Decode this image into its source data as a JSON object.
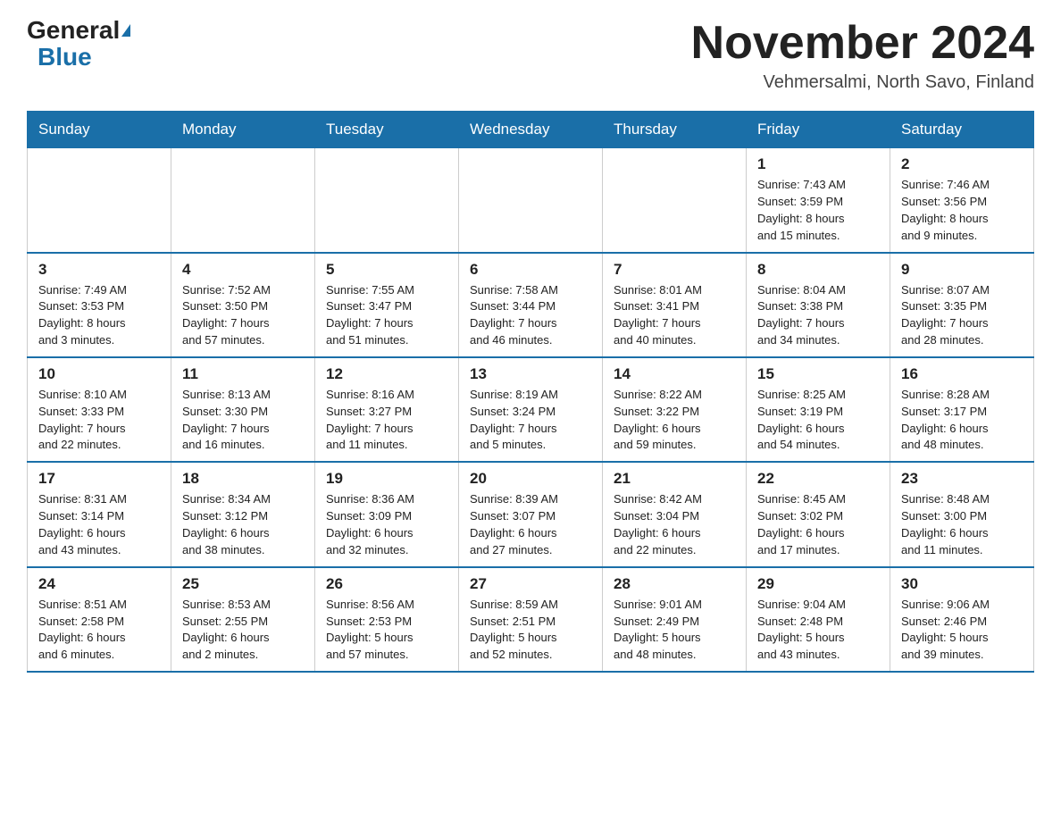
{
  "header": {
    "logo_general": "General",
    "logo_blue": "Blue",
    "month_title": "November 2024",
    "location": "Vehmersalmi, North Savo, Finland"
  },
  "days_of_week": [
    "Sunday",
    "Monday",
    "Tuesday",
    "Wednesday",
    "Thursday",
    "Friday",
    "Saturday"
  ],
  "weeks": [
    [
      {
        "day": "",
        "info": ""
      },
      {
        "day": "",
        "info": ""
      },
      {
        "day": "",
        "info": ""
      },
      {
        "day": "",
        "info": ""
      },
      {
        "day": "",
        "info": ""
      },
      {
        "day": "1",
        "info": "Sunrise: 7:43 AM\nSunset: 3:59 PM\nDaylight: 8 hours\nand 15 minutes."
      },
      {
        "day": "2",
        "info": "Sunrise: 7:46 AM\nSunset: 3:56 PM\nDaylight: 8 hours\nand 9 minutes."
      }
    ],
    [
      {
        "day": "3",
        "info": "Sunrise: 7:49 AM\nSunset: 3:53 PM\nDaylight: 8 hours\nand 3 minutes."
      },
      {
        "day": "4",
        "info": "Sunrise: 7:52 AM\nSunset: 3:50 PM\nDaylight: 7 hours\nand 57 minutes."
      },
      {
        "day": "5",
        "info": "Sunrise: 7:55 AM\nSunset: 3:47 PM\nDaylight: 7 hours\nand 51 minutes."
      },
      {
        "day": "6",
        "info": "Sunrise: 7:58 AM\nSunset: 3:44 PM\nDaylight: 7 hours\nand 46 minutes."
      },
      {
        "day": "7",
        "info": "Sunrise: 8:01 AM\nSunset: 3:41 PM\nDaylight: 7 hours\nand 40 minutes."
      },
      {
        "day": "8",
        "info": "Sunrise: 8:04 AM\nSunset: 3:38 PM\nDaylight: 7 hours\nand 34 minutes."
      },
      {
        "day": "9",
        "info": "Sunrise: 8:07 AM\nSunset: 3:35 PM\nDaylight: 7 hours\nand 28 minutes."
      }
    ],
    [
      {
        "day": "10",
        "info": "Sunrise: 8:10 AM\nSunset: 3:33 PM\nDaylight: 7 hours\nand 22 minutes."
      },
      {
        "day": "11",
        "info": "Sunrise: 8:13 AM\nSunset: 3:30 PM\nDaylight: 7 hours\nand 16 minutes."
      },
      {
        "day": "12",
        "info": "Sunrise: 8:16 AM\nSunset: 3:27 PM\nDaylight: 7 hours\nand 11 minutes."
      },
      {
        "day": "13",
        "info": "Sunrise: 8:19 AM\nSunset: 3:24 PM\nDaylight: 7 hours\nand 5 minutes."
      },
      {
        "day": "14",
        "info": "Sunrise: 8:22 AM\nSunset: 3:22 PM\nDaylight: 6 hours\nand 59 minutes."
      },
      {
        "day": "15",
        "info": "Sunrise: 8:25 AM\nSunset: 3:19 PM\nDaylight: 6 hours\nand 54 minutes."
      },
      {
        "day": "16",
        "info": "Sunrise: 8:28 AM\nSunset: 3:17 PM\nDaylight: 6 hours\nand 48 minutes."
      }
    ],
    [
      {
        "day": "17",
        "info": "Sunrise: 8:31 AM\nSunset: 3:14 PM\nDaylight: 6 hours\nand 43 minutes."
      },
      {
        "day": "18",
        "info": "Sunrise: 8:34 AM\nSunset: 3:12 PM\nDaylight: 6 hours\nand 38 minutes."
      },
      {
        "day": "19",
        "info": "Sunrise: 8:36 AM\nSunset: 3:09 PM\nDaylight: 6 hours\nand 32 minutes."
      },
      {
        "day": "20",
        "info": "Sunrise: 8:39 AM\nSunset: 3:07 PM\nDaylight: 6 hours\nand 27 minutes."
      },
      {
        "day": "21",
        "info": "Sunrise: 8:42 AM\nSunset: 3:04 PM\nDaylight: 6 hours\nand 22 minutes."
      },
      {
        "day": "22",
        "info": "Sunrise: 8:45 AM\nSunset: 3:02 PM\nDaylight: 6 hours\nand 17 minutes."
      },
      {
        "day": "23",
        "info": "Sunrise: 8:48 AM\nSunset: 3:00 PM\nDaylight: 6 hours\nand 11 minutes."
      }
    ],
    [
      {
        "day": "24",
        "info": "Sunrise: 8:51 AM\nSunset: 2:58 PM\nDaylight: 6 hours\nand 6 minutes."
      },
      {
        "day": "25",
        "info": "Sunrise: 8:53 AM\nSunset: 2:55 PM\nDaylight: 6 hours\nand 2 minutes."
      },
      {
        "day": "26",
        "info": "Sunrise: 8:56 AM\nSunset: 2:53 PM\nDaylight: 5 hours\nand 57 minutes."
      },
      {
        "day": "27",
        "info": "Sunrise: 8:59 AM\nSunset: 2:51 PM\nDaylight: 5 hours\nand 52 minutes."
      },
      {
        "day": "28",
        "info": "Sunrise: 9:01 AM\nSunset: 2:49 PM\nDaylight: 5 hours\nand 48 minutes."
      },
      {
        "day": "29",
        "info": "Sunrise: 9:04 AM\nSunset: 2:48 PM\nDaylight: 5 hours\nand 43 minutes."
      },
      {
        "day": "30",
        "info": "Sunrise: 9:06 AM\nSunset: 2:46 PM\nDaylight: 5 hours\nand 39 minutes."
      }
    ]
  ]
}
